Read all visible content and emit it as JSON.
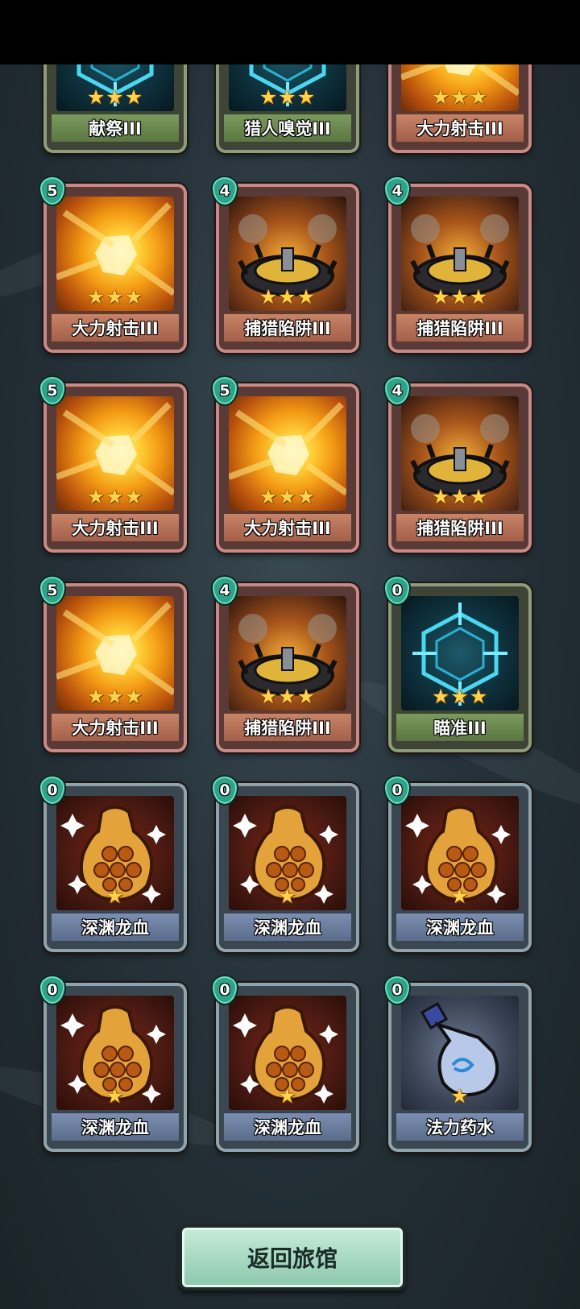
{
  "cards": [
    {
      "name": "献祭III",
      "cost": "",
      "stars": "★★★",
      "rarity": "grn",
      "art": "aim",
      "label": "grn"
    },
    {
      "name": "猎人嗅觉III",
      "cost": "",
      "stars": "★★★",
      "rarity": "grn",
      "art": "aim",
      "label": "grn"
    },
    {
      "name": "大力射击III",
      "cost": "",
      "stars": "★★★",
      "rarity": "red",
      "art": "power",
      "label": "red"
    },
    {
      "name": "大力射击III",
      "cost": "5",
      "stars": "★★★",
      "rarity": "red",
      "art": "power",
      "label": "red"
    },
    {
      "name": "捕猎陷阱III",
      "cost": "4",
      "stars": "★★★",
      "rarity": "red",
      "art": "trap",
      "label": "red"
    },
    {
      "name": "捕猎陷阱III",
      "cost": "4",
      "stars": "★★★",
      "rarity": "red",
      "art": "trap",
      "label": "red"
    },
    {
      "name": "大力射击III",
      "cost": "5",
      "stars": "★★★",
      "rarity": "red",
      "art": "power",
      "label": "red"
    },
    {
      "name": "大力射击III",
      "cost": "5",
      "stars": "★★★",
      "rarity": "red",
      "art": "power",
      "label": "red"
    },
    {
      "name": "捕猎陷阱III",
      "cost": "4",
      "stars": "★★★",
      "rarity": "red",
      "art": "trap",
      "label": "red"
    },
    {
      "name": "大力射击III",
      "cost": "5",
      "stars": "★★★",
      "rarity": "red",
      "art": "power",
      "label": "red"
    },
    {
      "name": "捕猎陷阱III",
      "cost": "4",
      "stars": "★★★",
      "rarity": "red",
      "art": "trap",
      "label": "red"
    },
    {
      "name": "瞄准III",
      "cost": "0",
      "stars": "★★★",
      "rarity": "grn",
      "art": "aim",
      "label": "grn"
    },
    {
      "name": "深渊龙血",
      "cost": "0",
      "stars": "★",
      "rarity": "blu",
      "art": "blood",
      "label": "blu"
    },
    {
      "name": "深渊龙血",
      "cost": "0",
      "stars": "★",
      "rarity": "blu",
      "art": "blood",
      "label": "blu"
    },
    {
      "name": "深渊龙血",
      "cost": "0",
      "stars": "★",
      "rarity": "blu",
      "art": "blood",
      "label": "blu"
    },
    {
      "name": "深渊龙血",
      "cost": "0",
      "stars": "★",
      "rarity": "blu",
      "art": "blood",
      "label": "blu"
    },
    {
      "name": "深渊龙血",
      "cost": "0",
      "stars": "★",
      "rarity": "blu",
      "art": "blood",
      "label": "blu"
    },
    {
      "name": "法力药水",
      "cost": "0",
      "stars": "★",
      "rarity": "blu",
      "art": "mana",
      "label": "blu"
    }
  ],
  "back_button": {
    "label": "返回旅馆"
  }
}
